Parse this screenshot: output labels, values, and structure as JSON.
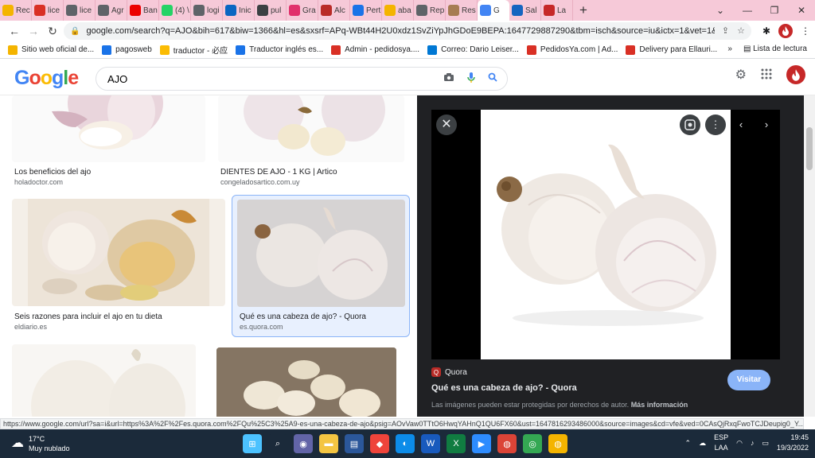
{
  "browser": {
    "tabs": [
      {
        "label": "Rec",
        "icon": "mcdonalds-icon",
        "color": "#f4b400"
      },
      {
        "label": "lice",
        "icon": "gmail-icon",
        "color": "#d93025"
      },
      {
        "label": "lice",
        "icon": "globe-icon",
        "color": "#5f6368"
      },
      {
        "label": "Agr",
        "icon": "globe-icon",
        "color": "#5f6368"
      },
      {
        "label": "Ban",
        "icon": "santander-icon",
        "color": "#ec0000"
      },
      {
        "label": "(4) \\",
        "icon": "whatsapp-icon",
        "color": "#25d366"
      },
      {
        "label": "logi",
        "icon": "globe-icon",
        "color": "#5f6368"
      },
      {
        "label": "Inic",
        "icon": "linkedin-icon",
        "color": "#0a66c2"
      },
      {
        "label": "pul",
        "icon": "chart-icon",
        "color": "#3c4043"
      },
      {
        "label": "Gra",
        "icon": "instagram-icon",
        "color": "#e1306c"
      },
      {
        "label": "Alc",
        "icon": "quora-icon",
        "color": "#b92b27"
      },
      {
        "label": "Pert",
        "icon": "a-icon",
        "color": "#1a73e8"
      },
      {
        "label": "aba",
        "icon": "mcdonalds-icon",
        "color": "#f4b400"
      },
      {
        "label": "Rep",
        "icon": "globe-icon",
        "color": "#5f6368"
      },
      {
        "label": "Res",
        "icon": "pan-icon",
        "color": "#a67c52"
      },
      {
        "label": "G",
        "icon": "google-icon",
        "color": "#4285f4"
      },
      {
        "label": "Sal",
        "icon": "p-icon",
        "color": "#1565c0"
      },
      {
        "label": "La",
        "icon": "lx-icon",
        "color": "#c62828"
      }
    ],
    "active_tab": 15,
    "new_tab_symbol": "+",
    "window_controls": [
      "⌄",
      "—",
      "❐",
      "✕"
    ],
    "url": "google.com/search?q=AJO&bih=617&biw=1366&hl=es&sxsrf=APq-WBt44H2U0xdz1SvZiYpJhGDoE9BEPA:1647729887290&tbm=isch&source=iu&ictx=1&vet=1&fir=...",
    "bookmarks": [
      {
        "label": "Sitio web oficial de...",
        "color": "#f4b400"
      },
      {
        "label": "pagosweb",
        "color": "#1a73e8"
      },
      {
        "label": "traductor - 必应",
        "color": "#fbbc04"
      },
      {
        "label": "Traductor inglés es...",
        "color": "#1a73e8"
      },
      {
        "label": "Admin - pedidosya....",
        "color": "#d93025"
      },
      {
        "label": "Correo: Dario Leiser...",
        "color": "#0078d4"
      },
      {
        "label": "PedidosYa.com | Ad...",
        "color": "#d93025"
      },
      {
        "label": "Delivery para Ellauri...",
        "color": "#d93025"
      }
    ],
    "bookmarks_more": "»",
    "reading_list": "Lista de lectura",
    "status_url": "https://www.google.com/url?sa=i&url=https%3A%2F%2Fes.quora.com%2FQu%25C3%25A9-es-una-cabeza-de-ajo&psig=AOvVaw0TTtO6HwqYAHnQ1QU6FX60&ust=1647816293486000&source=images&cd=vfe&ved=0CAsQjRxqFwoTCJDeupig0_Y..."
  },
  "google": {
    "logo": "Google",
    "logo_colors": [
      "#4285f4",
      "#ea4335",
      "#fbbc05",
      "#4285f4",
      "#34a853",
      "#ea4335"
    ],
    "query": "AJO",
    "avatar_color": "#c62828",
    "results": [
      {
        "title": "Los beneficios del ajo",
        "source": "holadoctor.com"
      },
      {
        "title": "DIENTES DE AJO - 1 KG | Artico",
        "source": "congeladosartico.com.uy"
      },
      {
        "title": "Seis razones para incluir el ajo en tu dieta",
        "source": "eldiario.es"
      },
      {
        "title": "Qué es una cabeza de ajo? - Quora",
        "source": "es.quora.com"
      }
    ],
    "selected_result": 3
  },
  "preview": {
    "source_name": "Quora",
    "title": "Qué es una cabeza de ajo? - Quora",
    "visit_label": "Visitar",
    "note": "Las imágenes pueden estar protegidas por derechos de autor.",
    "note_link": "Más información",
    "close_symbol": "✕"
  },
  "taskbar": {
    "temperature": "17°C",
    "weather": "Muy nublado",
    "language_1": "ESP",
    "language_2": "LAA",
    "time": "19:45",
    "date": "19/3/2022",
    "apps": [
      {
        "icon": "windows-start-icon",
        "color": "#4cc2ff"
      },
      {
        "icon": "search-icon",
        "color": "#1b2a3a"
      },
      {
        "icon": "teams-chat-icon",
        "color": "#6264a7"
      },
      {
        "icon": "file-explorer-icon",
        "color": "#f4c542"
      },
      {
        "icon": "word-doc-icon",
        "color": "#2b579a"
      },
      {
        "icon": "anydesk-icon",
        "color": "#ef443b"
      },
      {
        "icon": "edge-icon",
        "color": "#0c8ce9"
      },
      {
        "icon": "word-icon",
        "color": "#185abd"
      },
      {
        "icon": "excel-icon",
        "color": "#107c41"
      },
      {
        "icon": "zoom-icon",
        "color": "#2d8cff"
      },
      {
        "icon": "chrome-icon",
        "color": "#db4437"
      },
      {
        "icon": "gmaps-icon",
        "color": "#34a853"
      },
      {
        "icon": "chrome-icon",
        "color": "#f4b400"
      }
    ]
  }
}
